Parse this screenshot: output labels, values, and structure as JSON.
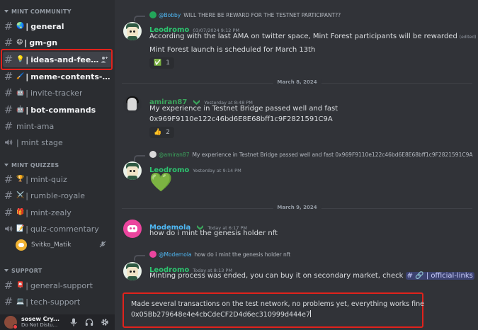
{
  "sidebar": {
    "categories": [
      {
        "label": "MINT COMMUNITY"
      },
      {
        "label": "MINT QUIZZES"
      },
      {
        "label": "SUPPORT"
      }
    ],
    "channels": [
      {
        "emoji": "🌏",
        "sep": "|",
        "name": "general",
        "icon": "hash"
      },
      {
        "emoji": "😃",
        "sep": "|",
        "name": "gm-gn",
        "icon": "hash"
      },
      {
        "emoji": "💡",
        "sep": "|",
        "name": "ideas-and-feedba...",
        "icon": "hash"
      },
      {
        "emoji": "🖌️",
        "sep": "|",
        "name": "meme-contents-sh...",
        "icon": "hash"
      },
      {
        "emoji": "🤖",
        "sep": "|",
        "name": "invite-tracker",
        "icon": "hash"
      },
      {
        "emoji": "🤖",
        "sep": "|",
        "name": "bot-commands",
        "icon": "hash"
      },
      {
        "emoji": "",
        "sep": "",
        "name": "mint-ama",
        "icon": "hash"
      },
      {
        "emoji": "",
        "sep": "|",
        "name": "mint stage",
        "icon": "stage"
      },
      {
        "emoji": "🏆",
        "sep": "|",
        "name": "mint-quiz",
        "icon": "hash"
      },
      {
        "emoji": "⚔️",
        "sep": "|",
        "name": "rumble-royale",
        "icon": "hash"
      },
      {
        "emoji": "🎁",
        "sep": "|",
        "name": "mint-zealy",
        "icon": "hash"
      },
      {
        "emoji": "📝",
        "sep": "|",
        "name": "quiz-commentary",
        "icon": "stage"
      },
      {
        "emoji": "📮",
        "sep": "|",
        "name": "general-support",
        "icon": "hash"
      },
      {
        "emoji": "💻",
        "sep": "|",
        "name": "tech-support",
        "icon": "hash"
      }
    ],
    "voice_user": "Svitko_Matik",
    "user": {
      "name": "sosew Cry...",
      "status": "Do Not Distu..."
    }
  },
  "chat": {
    "messages": [
      {
        "reply": {
          "name": "@Bobby",
          "text": "WILL THERE BE REWARD FOR THE TESTNET PARTICIPANT??"
        },
        "author": "Leodromo",
        "timestamp": "03/07/2024 9:12 PM",
        "lines": [
          "According with the last AMA on twitter space, Mint Forest participants will be rewarded",
          "Mint Forest launch is scheduled for March 13th"
        ],
        "edited": "(edited)",
        "reaction": {
          "emoji": "✅",
          "count": "1"
        }
      },
      {
        "author": "amiran87",
        "timestamp": "Yesterday at 8:48 PM",
        "lines": [
          "My experience in Testnet Bridge passed well and fast",
          "0x969F9110e122c46bd6E8E68bff1c9F2821591C9A"
        ],
        "reaction": {
          "emoji": "👍",
          "count": "2"
        }
      },
      {
        "reply": {
          "name": "@amiran87",
          "text": "My experience in Testnet Bridge passed well and fast 0x969F9110e122c46bd6E8E68bff1c9F2821591C9A"
        },
        "author": "Leodromo",
        "timestamp": "Yesterday at 9:14 PM",
        "emoji_body": "💚"
      },
      {
        "author": "Modemola",
        "timestamp": "Today at 6:17 PM",
        "lines": [
          "how do i mint the genesis holder nft"
        ]
      },
      {
        "reply": {
          "name": "@Modemola",
          "text": "how do i mint the genesis holder nft"
        },
        "author": "Leodromo",
        "timestamp": "Today at 8:13 PM",
        "line_prefix": "Minting process was ended, you can buy it on secondary market, check",
        "mention": "# 🔗 | official-links"
      }
    ],
    "dividers": [
      "March 8, 2024",
      "March 9, 2024"
    ],
    "composer": {
      "line1": "Made several transactions on the test network, no problems yet, everything works fine",
      "line2": "0x05Bb279648e4e4cbCdeCF2D4d6ec310999d444e7"
    }
  },
  "colors": {
    "leodromo": "#2dc770",
    "amiran87": "#3ba55c",
    "modemola": "#4fb8f4",
    "highlight": "#e0221c"
  }
}
